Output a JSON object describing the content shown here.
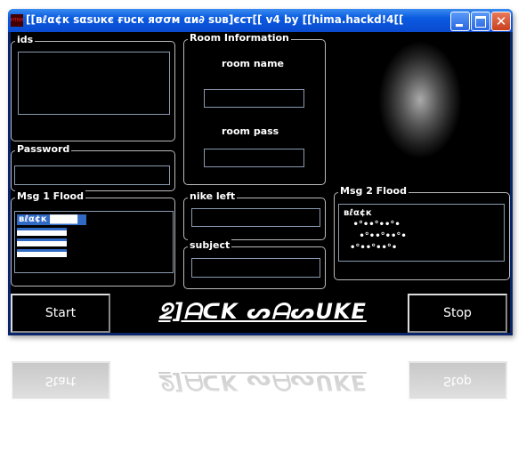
{
  "window": {
    "title": "[[вℓα¢к ѕαѕυкє ғυcк яσσм αи∂ ѕυв]єcт[[  v4  by [[hima.hackd!4[[",
    "icon_text": "HTNH"
  },
  "groups": {
    "ids": "ids",
    "password": "Password",
    "msg1": "Msg 1 Flood",
    "room": "Room Information",
    "nike": "nike left",
    "subject": "subject",
    "msg2": "Msg 2 Flood"
  },
  "room": {
    "name_label": "room name",
    "pass_label": "room pass",
    "name_value": "",
    "pass_value": ""
  },
  "msg1_items": [
    "вℓα¢к ▇▇▇▇",
    "",
    "",
    ""
  ],
  "msg2_lines": [
    "вℓα¢к",
    "   •°••°••°•",
    "     •°••°••°•",
    "  •°••°••°•"
  ],
  "buttons": {
    "start": "Start",
    "stop": "Stop"
  },
  "logo": "ᘖ]ᗩᑕK ᔕᗩᔕᑌKE"
}
